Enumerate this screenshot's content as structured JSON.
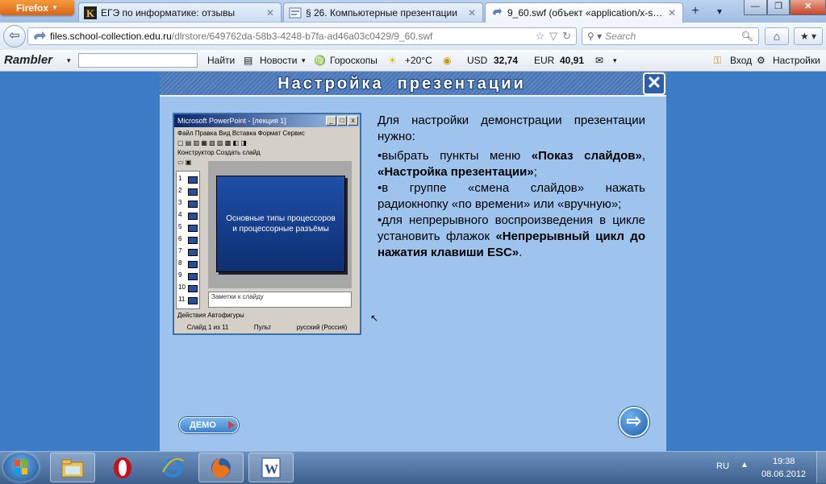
{
  "browser": {
    "menu_label": "Firefox",
    "tabs": [
      {
        "title": "ЕГЭ по информатике: отзывы",
        "active": false
      },
      {
        "title": "§ 26. Компьютерные презентации",
        "active": false
      },
      {
        "title": "9_60.swf (объект «application/x-shoc...",
        "active": true
      }
    ],
    "new_tab": "+",
    "url_domain": "files.school-collection.edu.ru",
    "url_path": "/dlrstore/649762da-58b3-4248-b7fa-ad46a03c0429/9_60.swf",
    "search_placeholder": "Search"
  },
  "rambler": {
    "logo": "Rambler",
    "find": "Найти",
    "news": "Новости",
    "horoscopes": "Гороскопы",
    "temperature": "+20°C",
    "usd_label": "USD",
    "usd_value": "32,74",
    "eur_label": "EUR",
    "eur_value": "40,91",
    "login": "Вход",
    "settings": "Настройки"
  },
  "flash": {
    "title": "Настройка  презентации",
    "demo_label": "ДЕМО",
    "ppt": {
      "window_title": "Microsoft PowerPoint - [лекция 1]",
      "menu": "Файл  Правка  Вид  Вставка  Формат  Сервис",
      "toolbar1": "Конструктор  Создать слайд",
      "slide_text": "Основные типы процессоров и процессорные разъёмы",
      "notes": "Заметки к слайду",
      "draw": "Действия  Автофигуры",
      "status": [
        "Слайд 1 из 11",
        "Пульт",
        "русский (Россия)"
      ],
      "slide_numbers": [
        "1",
        "2",
        "3",
        "4",
        "5",
        "6",
        "7",
        "8",
        "9",
        "10",
        "11"
      ]
    },
    "desc": {
      "intro": "Для настройки демонстрации презентации нужно:",
      "b1_pre": "•выбрать пункты меню ",
      "b1_bold1": "«Показ слайдов»",
      "b1_mid": ", ",
      "b1_bold2": "«Настройка презентации»",
      "b1_end": ";",
      "b2": "•в группе «смена слайдов» нажать радиокнопку «по времени» или «вручную»;",
      "b3_pre": "•для непрерывного воспроизведения в цикле установить флажок ",
      "b3_bold": "«Непрерывный цикл до нажатия клавиши ESC»",
      "b3_end": "."
    }
  },
  "taskbar": {
    "lang": "RU",
    "time": "19:38",
    "date": "08.06.2012"
  }
}
